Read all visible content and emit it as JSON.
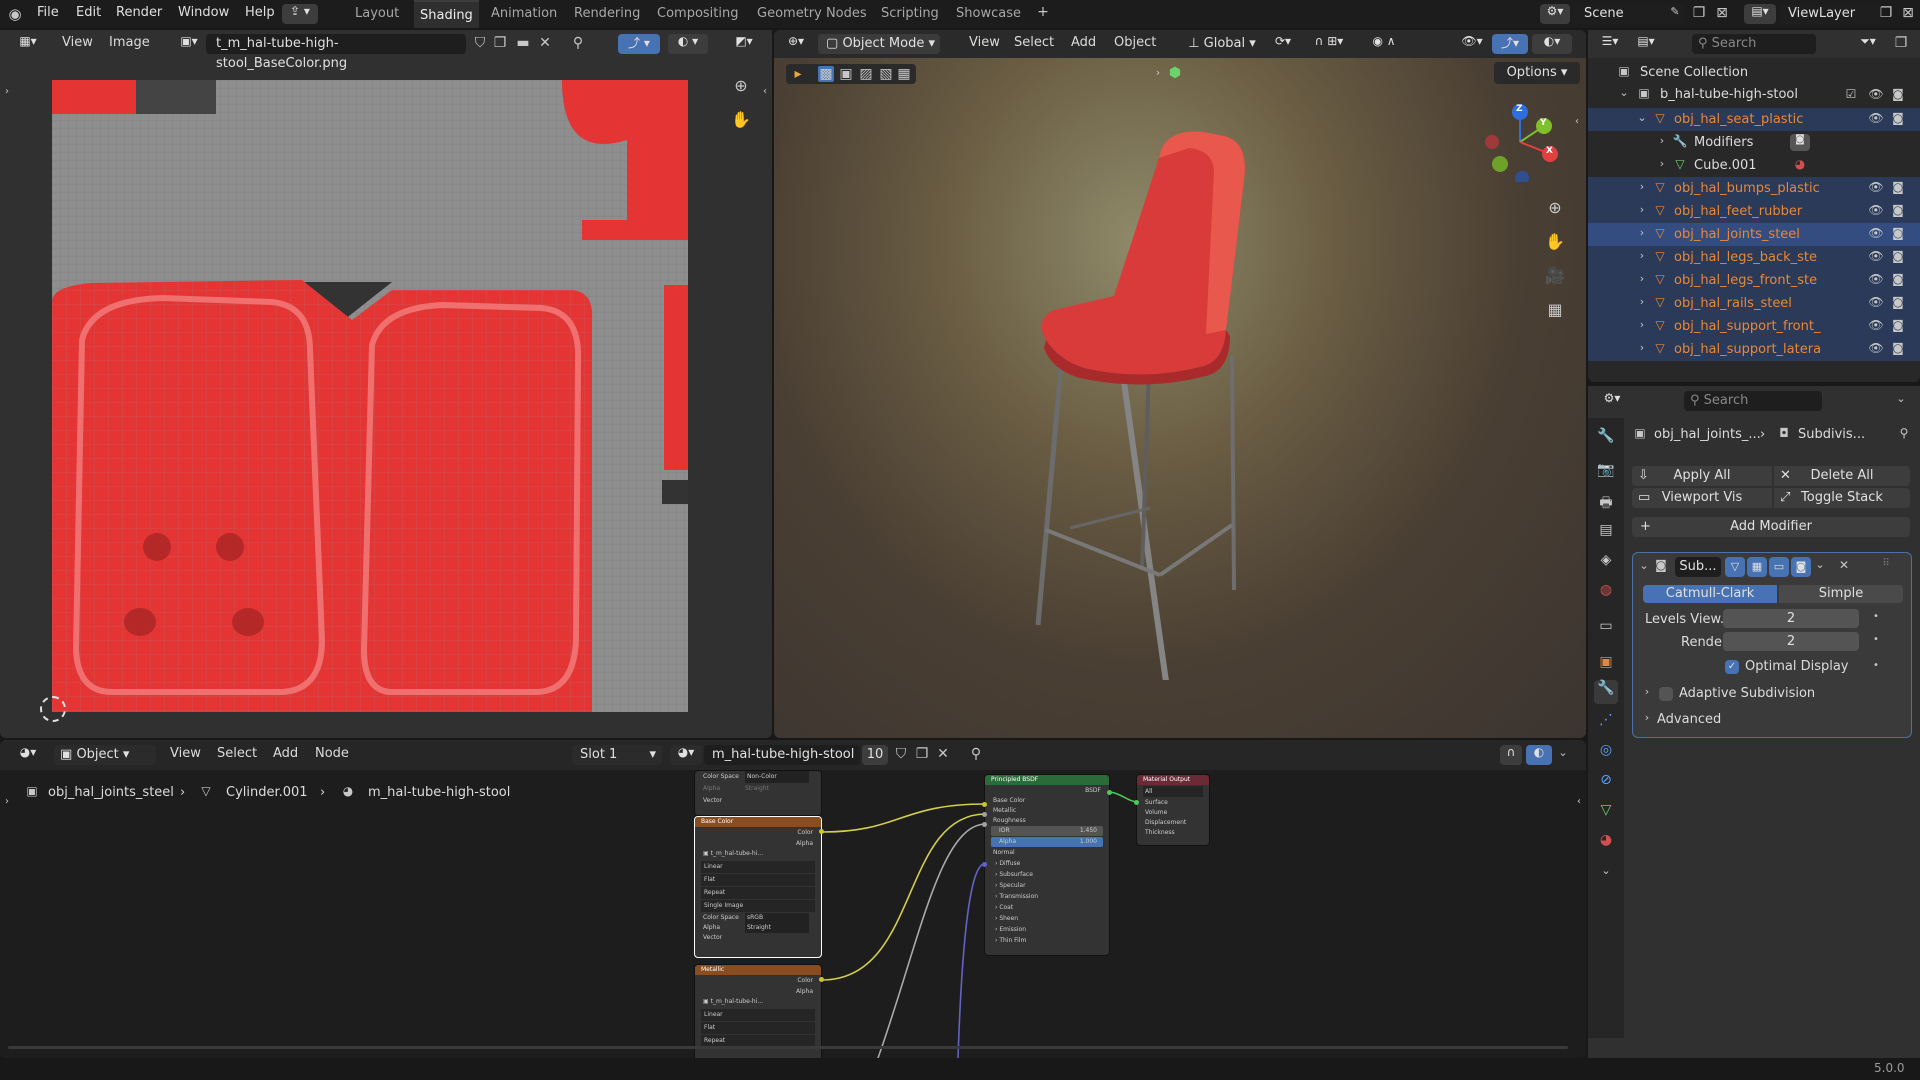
{
  "menubar": {
    "items": [
      "File",
      "Edit",
      "Render",
      "Window",
      "Help"
    ],
    "workspaces": [
      "Layout",
      "Shading",
      "Animation",
      "Rendering",
      "Compositing",
      "Geometry Nodes",
      "Scripting",
      "Showcase"
    ],
    "active_workspace": "Shading",
    "scene_label": "Scene",
    "viewlayer_label": "ViewLayer"
  },
  "image_editor": {
    "view_menu": "View",
    "image_menu": "Image",
    "image_name": "t_m_hal-tube-high-stool_BaseColor.png"
  },
  "viewport": {
    "mode": "Object Mode",
    "menus": [
      "View",
      "Select",
      "Add",
      "Object"
    ],
    "transform_orientation": "Global",
    "options_label": "Options",
    "gizmo": {
      "x": "X",
      "y": "Y",
      "z": "Z"
    }
  },
  "outliner": {
    "search_placeholder": "Search",
    "scene_collection": "Scene Collection",
    "collection": "b_hal-tube-high-stool",
    "items": [
      {
        "name": "obj_hal_seat_plastic",
        "level": 1,
        "expanded": true
      },
      {
        "name": "Modifiers",
        "level": 2
      },
      {
        "name": "Cube.001",
        "level": 2
      },
      {
        "name": "obj_hal_bumps_plastic",
        "level": 1
      },
      {
        "name": "obj_hal_feet_rubber",
        "level": 1
      },
      {
        "name": "obj_hal_joints_steel",
        "level": 1,
        "active": true
      },
      {
        "name": "obj_hal_legs_back_ste",
        "level": 1
      },
      {
        "name": "obj_hal_legs_front_ste",
        "level": 1
      },
      {
        "name": "obj_hal_rails_steel",
        "level": 1
      },
      {
        "name": "obj_hal_support_front_",
        "level": 1
      },
      {
        "name": "obj_hal_support_latera",
        "level": 1
      }
    ]
  },
  "properties": {
    "search_placeholder": "Search",
    "breadcrumb_object": "obj_hal_joints_...",
    "breadcrumb_modifier": "Subdivis...",
    "apply_all": "Apply All",
    "delete_all": "Delete All",
    "viewport_vis": "Viewport Vis",
    "toggle_stack": "Toggle Stack",
    "add_modifier": "Add Modifier",
    "modifier_name": "Sub...",
    "catmull_clark": "Catmull-Clark",
    "simple": "Simple",
    "levels_viewport_label": "Levels View...",
    "levels_viewport_value": "2",
    "render_label": "Render",
    "render_value": "2",
    "optimal_display": "Optimal Display",
    "adaptive_subdivision": "Adaptive Subdivision",
    "advanced": "Advanced"
  },
  "node_editor": {
    "object_menu": "Object",
    "menus": [
      "View",
      "Select",
      "Add",
      "Node"
    ],
    "slot": "Slot 1",
    "material": "m_hal-tube-high-stool",
    "user_count": "10",
    "breadcrumb": [
      "obj_hal_joints_steel",
      "Cylinder.001",
      "m_hal-tube-high-stool"
    ],
    "nodes": {
      "top_partial": {
        "rows": [
          "Color Space",
          "Alpha",
          "Vector"
        ],
        "values": [
          "Non-Color",
          "Straight"
        ]
      },
      "base_color": {
        "title": "Base Color",
        "outputs": [
          "Color",
          "Alpha"
        ],
        "image": "t_m_hal-tube-hi...",
        "options": [
          "Linear",
          "Flat",
          "Repeat",
          "Single Image"
        ],
        "color_space": "sRGB",
        "alpha": "Straight",
        "vector": "Vector"
      },
      "metallic": {
        "title": "Metallic",
        "outputs": [
          "Color",
          "Alpha"
        ],
        "image": "t_m_hal-tube-hi...",
        "options": [
          "Linear",
          "Flat",
          "Repeat"
        ]
      },
      "principled": {
        "title": "Principled BSDF",
        "output": "BSDF",
        "inputs": [
          "Base Color",
          "Metallic",
          "Roughness",
          "IOR",
          "Alpha",
          "Normal"
        ],
        "ior": "1.450",
        "alpha": "1.000",
        "panels": [
          "Diffuse",
          "Subsurface",
          "Specular",
          "Transmission",
          "Coat",
          "Sheen",
          "Emission",
          "Thin Film"
        ]
      },
      "output": {
        "title": "Material Output",
        "target": "All",
        "inputs": [
          "Surface",
          "Volume",
          "Displacement",
          "Thickness"
        ]
      }
    }
  },
  "status": {
    "version": "5.0.0"
  },
  "colors": {
    "accent": "#4772b3",
    "selected_row": "#334d80",
    "object_orange": "#e8873a",
    "seat_red": "#e03a3a"
  }
}
